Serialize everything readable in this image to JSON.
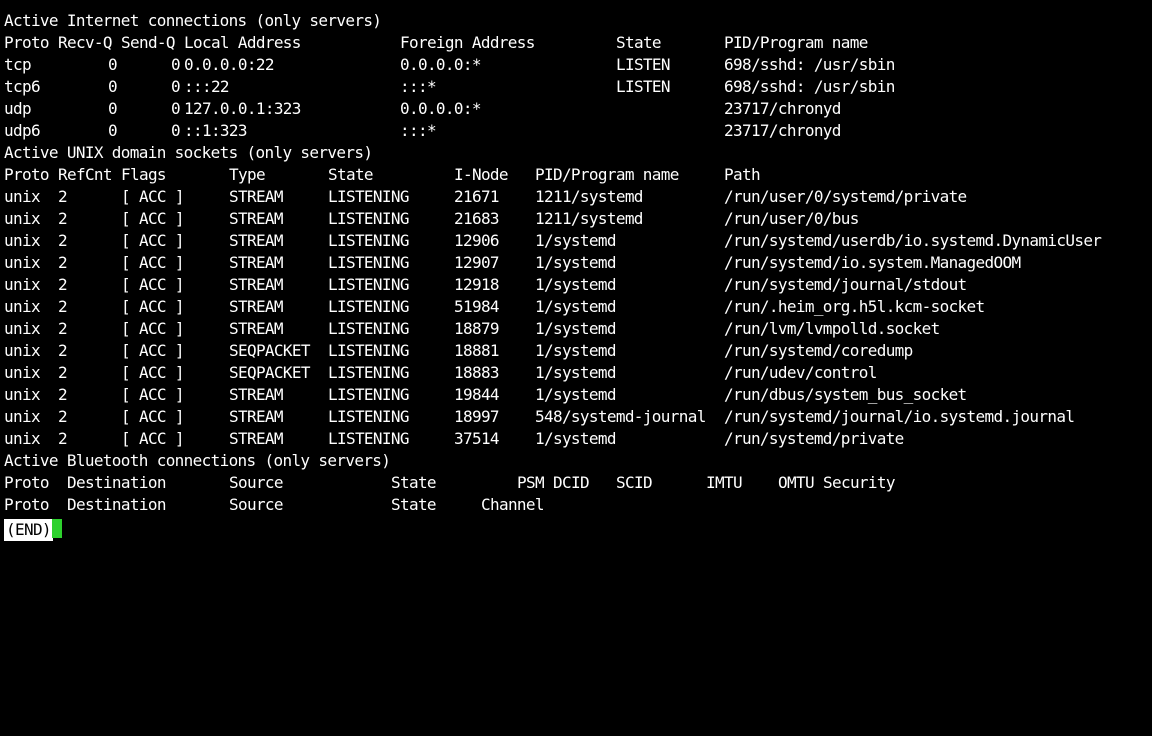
{
  "inet": {
    "heading": "Active Internet connections (only servers)",
    "columns": {
      "proto": "Proto",
      "recvq": "Recv-Q",
      "sendq": "Send-Q",
      "local": "Local Address",
      "foreign": "Foreign Address",
      "state": "State",
      "pid": "PID/Program name"
    },
    "rows": [
      {
        "proto": "tcp",
        "recvq": "0",
        "sendq": "0",
        "local": "0.0.0.0:22",
        "foreign": "0.0.0.0:*",
        "state": "LISTEN",
        "pid": "698/sshd: /usr/sbin"
      },
      {
        "proto": "tcp6",
        "recvq": "0",
        "sendq": "0",
        "local": ":::22",
        "foreign": ":::*",
        "state": "LISTEN",
        "pid": "698/sshd: /usr/sbin"
      },
      {
        "proto": "udp",
        "recvq": "0",
        "sendq": "0",
        "local": "127.0.0.1:323",
        "foreign": "0.0.0.0:*",
        "state": "",
        "pid": "23717/chronyd"
      },
      {
        "proto": "udp6",
        "recvq": "0",
        "sendq": "0",
        "local": "::1:323",
        "foreign": ":::*",
        "state": "",
        "pid": "23717/chronyd"
      }
    ]
  },
  "unix": {
    "heading": "Active UNIX domain sockets (only servers)",
    "columns": {
      "proto": "Proto",
      "refcnt": "RefCnt",
      "flags": "Flags",
      "type": "Type",
      "state": "State",
      "inode": "I-Node",
      "pid": "PID/Program name",
      "path": "Path"
    },
    "rows": [
      {
        "proto": "unix",
        "refcnt": "2",
        "flags": "[ ACC ]",
        "type": "STREAM",
        "state": "LISTENING",
        "inode": "21671",
        "pid": "1211/systemd",
        "path": "/run/user/0/systemd/private"
      },
      {
        "proto": "unix",
        "refcnt": "2",
        "flags": "[ ACC ]",
        "type": "STREAM",
        "state": "LISTENING",
        "inode": "21683",
        "pid": "1211/systemd",
        "path": "/run/user/0/bus"
      },
      {
        "proto": "unix",
        "refcnt": "2",
        "flags": "[ ACC ]",
        "type": "STREAM",
        "state": "LISTENING",
        "inode": "12906",
        "pid": "1/systemd",
        "path": "/run/systemd/userdb/io.systemd.DynamicUser"
      },
      {
        "proto": "unix",
        "refcnt": "2",
        "flags": "[ ACC ]",
        "type": "STREAM",
        "state": "LISTENING",
        "inode": "12907",
        "pid": "1/systemd",
        "path": "/run/systemd/io.system.ManagedOOM"
      },
      {
        "proto": "unix",
        "refcnt": "2",
        "flags": "[ ACC ]",
        "type": "STREAM",
        "state": "LISTENING",
        "inode": "12918",
        "pid": "1/systemd",
        "path": "/run/systemd/journal/stdout"
      },
      {
        "proto": "unix",
        "refcnt": "2",
        "flags": "[ ACC ]",
        "type": "STREAM",
        "state": "LISTENING",
        "inode": "51984",
        "pid": "1/systemd",
        "path": "/run/.heim_org.h5l.kcm-socket"
      },
      {
        "proto": "unix",
        "refcnt": "2",
        "flags": "[ ACC ]",
        "type": "STREAM",
        "state": "LISTENING",
        "inode": "18879",
        "pid": "1/systemd",
        "path": "/run/lvm/lvmpolld.socket"
      },
      {
        "proto": "unix",
        "refcnt": "2",
        "flags": "[ ACC ]",
        "type": "SEQPACKET",
        "state": "LISTENING",
        "inode": "18881",
        "pid": "1/systemd",
        "path": "/run/systemd/coredump"
      },
      {
        "proto": "unix",
        "refcnt": "2",
        "flags": "[ ACC ]",
        "type": "SEQPACKET",
        "state": "LISTENING",
        "inode": "18883",
        "pid": "1/systemd",
        "path": "/run/udev/control"
      },
      {
        "proto": "unix",
        "refcnt": "2",
        "flags": "[ ACC ]",
        "type": "STREAM",
        "state": "LISTENING",
        "inode": "19844",
        "pid": "1/systemd",
        "path": "/run/dbus/system_bus_socket"
      },
      {
        "proto": "unix",
        "refcnt": "2",
        "flags": "[ ACC ]",
        "type": "STREAM",
        "state": "LISTENING",
        "inode": "18997",
        "pid": "548/systemd-journal",
        "path": "/run/systemd/journal/io.systemd.journal"
      },
      {
        "proto": "unix",
        "refcnt": "2",
        "flags": "[ ACC ]",
        "type": "STREAM",
        "state": "LISTENING",
        "inode": "37514",
        "pid": "1/systemd",
        "path": "/run/systemd/private"
      }
    ]
  },
  "bluetooth": {
    "heading": "Active Bluetooth connections (only servers)",
    "header1": {
      "proto": "Proto",
      "destination": "Destination",
      "source": "Source",
      "state": "State",
      "psm": "PSM",
      "dcid": "DCID",
      "scid": "SCID",
      "imtu": "IMTU",
      "omtu": "OMTU",
      "security": "Security"
    },
    "header2": {
      "proto": "Proto",
      "destination": "Destination",
      "source": "Source",
      "state": "State",
      "channel": "Channel"
    }
  },
  "status": {
    "pager": "(END)",
    "cursor_color": "#2dd12d"
  }
}
